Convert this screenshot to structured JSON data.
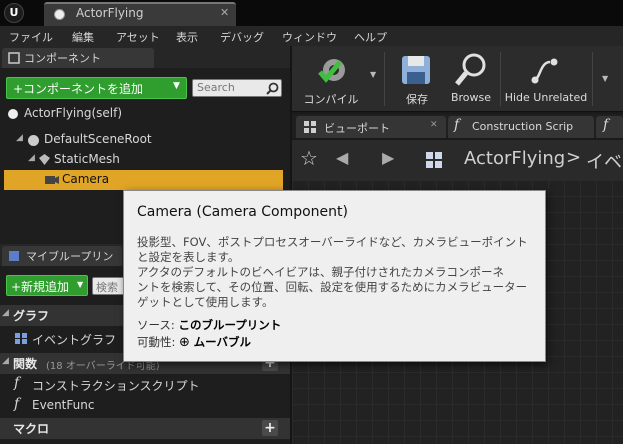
{
  "window": {
    "tab_title": "ActorFlying",
    "tab_close": "✕",
    "logo": "U"
  },
  "menu": [
    "ファイル",
    "編集",
    "アセット",
    "表示",
    "デバッグ",
    "ウィンドウ",
    "ヘルプ"
  ],
  "components_panel": {
    "tab_label": "コンポーネント",
    "add_button": "+コンポーネントを追加",
    "search_placeholder": "Search",
    "tree": [
      {
        "label": "ActorFlying(self)"
      },
      {
        "label": "DefaultSceneRoot"
      },
      {
        "label": "StaticMesh"
      },
      {
        "label": "Camera"
      }
    ]
  },
  "my_blueprint_panel": {
    "tab_label": "マイブループリン",
    "add_new_button": "+新規追加",
    "search_placeholder": "検索",
    "sections": {
      "graphs": "グラフ",
      "event_graph": "イベントグラフ",
      "functions": "関数",
      "functions_hint": "(18 オーバーライド可能)",
      "construction_script": "コンストラクションスクリプト",
      "event_func": "EventFunc",
      "macros": "マクロ"
    }
  },
  "toolbar": {
    "compile": "コンパイル",
    "save": "保存",
    "browse": "Browse",
    "hide_unrelated": "Hide Unrelated"
  },
  "editor_tabs": [
    {
      "label": "ビューポート",
      "close": "✕"
    },
    {
      "label": "Construction Scrip",
      "close": "✕"
    },
    {
      "label": "f"
    }
  ],
  "breadcrumb": {
    "root": "ActorFlying",
    "separator": ">",
    "next": "イベ"
  },
  "tooltip": {
    "title": "Camera (Camera Component)",
    "lines": [
      "投影型、FOV、ポストプロセスオーバーライドなど、カメラビューポイント",
      "と設定を表します。",
      "アクタのデフォルトのビヘイビアは、親子付けされたカメラコンポーネ",
      "ントを検索して、その位置、回転、設定を使用するためにカメラビューター",
      "ゲットとして使用します。"
    ],
    "source_label": "ソース:",
    "source_value": "このブループリント",
    "mobility_label": "可動性:",
    "mobility_value": "ムーバブル"
  },
  "colors": {
    "accent_green": "#2f9e2f",
    "selection": "#e0a526"
  },
  "icons": [
    "ue-logo",
    "blueprint-dot-icon",
    "search-icon",
    "compile-icon",
    "save-icon",
    "browse-icon",
    "hide-unrelated-icon",
    "viewport-icon",
    "function-icon",
    "star-icon",
    "back-icon",
    "forward-icon",
    "grid-icon",
    "camera-icon",
    "mesh-icon",
    "scene-root-icon",
    "plus-icon",
    "move-icon"
  ]
}
